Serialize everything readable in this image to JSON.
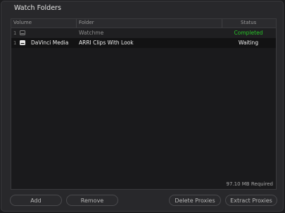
{
  "window": {
    "title": "Watch Folders"
  },
  "table": {
    "headers": {
      "volume": "Volume",
      "folder": "Folder",
      "status": "Status"
    },
    "rows": [
      {
        "num": "1",
        "volume": "",
        "folder": "Watchme",
        "status": "Completed"
      },
      {
        "num": "1",
        "volume": "DaVinci Media",
        "folder": "ARRI Clips With Look",
        "status": "Waiting"
      }
    ]
  },
  "footer": {
    "required": "97.10 MB Required"
  },
  "buttons": {
    "add": "Add",
    "remove": "Remove",
    "delete_proxies": "Delete Proxies",
    "extract_proxies": "Extract Proxies"
  },
  "colors": {
    "completed": "#27c227",
    "background": "#28282b",
    "table_bg": "#1a1a1c"
  },
  "icons": {
    "volume": "drive-icon"
  }
}
